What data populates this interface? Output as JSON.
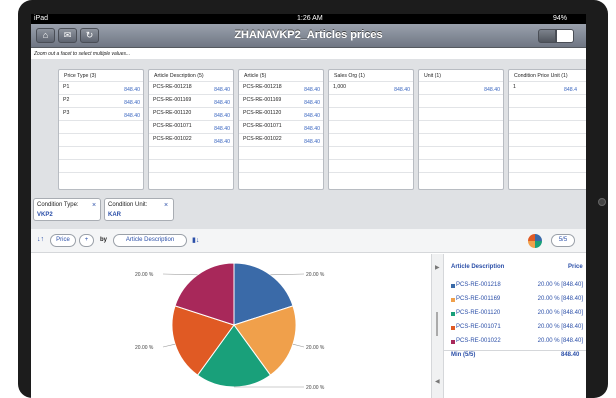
{
  "status": {
    "device": "iPad",
    "time": "1:26 AM",
    "battery": "94%"
  },
  "header": {
    "title": "ZHANAVKP2_Articles prices"
  },
  "hint": "Zoom out a facet to select multiple values...",
  "facets": [
    {
      "title": "Price Type (3)",
      "rows": [
        {
          "label": "P1",
          "value": "848.40"
        },
        {
          "label": "P2",
          "value": "848.40"
        },
        {
          "label": "P3",
          "value": "848.40"
        }
      ]
    },
    {
      "title": "Article Description (5)",
      "rows": [
        {
          "label": "PCS-RE-001218",
          "value": "848.40"
        },
        {
          "label": "PCS-RE-001169",
          "value": "848.40"
        },
        {
          "label": "PCS-RE-001120",
          "value": "848.40"
        },
        {
          "label": "PCS-RE-001071",
          "value": "848.40"
        },
        {
          "label": "PCS-RE-001022",
          "value": "848.40"
        }
      ]
    },
    {
      "title": "Article (5)",
      "rows": [
        {
          "label": "PCS-RE-001218",
          "value": "848.40"
        },
        {
          "label": "PCS-RE-001169",
          "value": "848.40"
        },
        {
          "label": "PCS-RE-001120",
          "value": "848.40"
        },
        {
          "label": "PCS-RE-001071",
          "value": "848.40"
        },
        {
          "label": "PCS-RE-001022",
          "value": "848.40"
        }
      ]
    },
    {
      "title": "Sales Org (1)",
      "rows": [
        {
          "label": "1,000",
          "value": "848.40"
        }
      ]
    },
    {
      "title": "Unit (1)",
      "rows": [
        {
          "label": "",
          "value": "848.40"
        }
      ]
    },
    {
      "title": "Condition Price Unit (1)",
      "rows": [
        {
          "label": "1",
          "value": "848.4"
        }
      ]
    }
  ],
  "filters": [
    {
      "label": "Condition Type:",
      "value": "VKP2",
      "remove": "×"
    },
    {
      "label": "Condition Unit:",
      "value": "KAR",
      "remove": "×"
    }
  ],
  "toolbar": {
    "sort_icon": "↓↑",
    "measure": "Price",
    "add": "+",
    "by": "by",
    "dimension": "Article Description",
    "chart_icon": "▮↓",
    "count": "5/5"
  },
  "chart_data": {
    "type": "pie",
    "categories": [
      "PCS-RE-001218",
      "PCS-RE-001169",
      "PCS-RE-001120",
      "PCS-RE-001071",
      "PCS-RE-001022"
    ],
    "values": [
      20,
      20,
      20,
      20,
      20
    ],
    "labels": [
      "20.00 %",
      "20.00 %",
      "20.00 %",
      "20.00 %",
      "20.00 %"
    ],
    "colors": [
      "#3a6aa8",
      "#f0a04b",
      "#19a07a",
      "#e05a24",
      "#a8285a"
    ]
  },
  "legend": {
    "header_name": "Article Description",
    "header_value": "Price",
    "rows": [
      {
        "name": "PCS-RE-001218",
        "value": "20.00 % [848.40]"
      },
      {
        "name": "PCS-RE-001169",
        "value": "20.00 % [848.40]"
      },
      {
        "name": "PCS-RE-001120",
        "value": "20.00 % [848.40]"
      },
      {
        "name": "PCS-RE-001071",
        "value": "20.00 % [848.40]"
      },
      {
        "name": "PCS-RE-001022",
        "value": "20.00 % [848.40]"
      }
    ],
    "footer_label": "Min (5/5)",
    "footer_value": "848.40"
  },
  "icons": {
    "home": "home-icon",
    "mail": "mail-icon",
    "refresh": "refresh-icon"
  }
}
